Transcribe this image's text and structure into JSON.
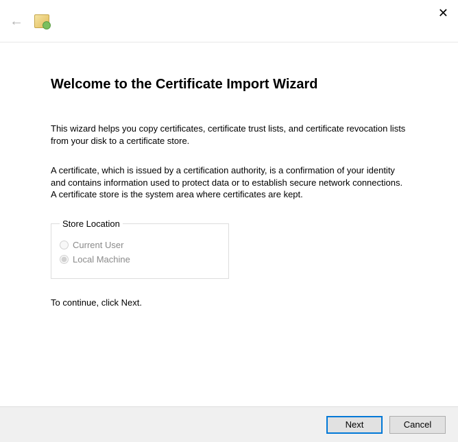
{
  "window": {
    "close_label": "✕"
  },
  "heading": "Welcome to the Certificate Import Wizard",
  "intro_para": "This wizard helps you copy certificates, certificate trust lists, and certificate revocation lists from your disk to a certificate store.",
  "explain_para": "A certificate, which is issued by a certification authority, is a confirmation of your identity and contains information used to protect data or to establish secure network connections. A certificate store is the system area where certificates are kept.",
  "store_location": {
    "legend": "Store Location",
    "options": {
      "current_user": "Current User",
      "local_machine": "Local Machine"
    },
    "selected": "local_machine",
    "enabled": false
  },
  "continue_hint": "To continue, click Next.",
  "buttons": {
    "next": "Next",
    "cancel": "Cancel"
  }
}
